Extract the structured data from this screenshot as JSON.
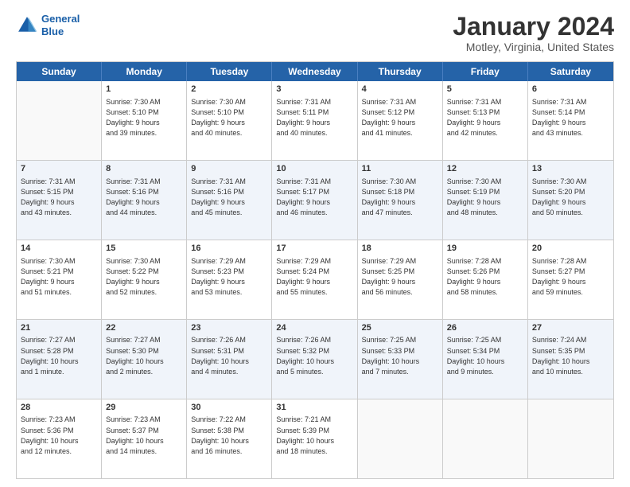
{
  "logo": {
    "line1": "General",
    "line2": "Blue"
  },
  "title": "January 2024",
  "subtitle": "Motley, Virginia, United States",
  "days": [
    "Sunday",
    "Monday",
    "Tuesday",
    "Wednesday",
    "Thursday",
    "Friday",
    "Saturday"
  ],
  "rows": [
    [
      {
        "day": "",
        "text": ""
      },
      {
        "day": "1",
        "text": "Sunrise: 7:30 AM\nSunset: 5:10 PM\nDaylight: 9 hours\nand 39 minutes."
      },
      {
        "day": "2",
        "text": "Sunrise: 7:30 AM\nSunset: 5:10 PM\nDaylight: 9 hours\nand 40 minutes."
      },
      {
        "day": "3",
        "text": "Sunrise: 7:31 AM\nSunset: 5:11 PM\nDaylight: 9 hours\nand 40 minutes."
      },
      {
        "day": "4",
        "text": "Sunrise: 7:31 AM\nSunset: 5:12 PM\nDaylight: 9 hours\nand 41 minutes."
      },
      {
        "day": "5",
        "text": "Sunrise: 7:31 AM\nSunset: 5:13 PM\nDaylight: 9 hours\nand 42 minutes."
      },
      {
        "day": "6",
        "text": "Sunrise: 7:31 AM\nSunset: 5:14 PM\nDaylight: 9 hours\nand 43 minutes."
      }
    ],
    [
      {
        "day": "7",
        "text": "Sunrise: 7:31 AM\nSunset: 5:15 PM\nDaylight: 9 hours\nand 43 minutes."
      },
      {
        "day": "8",
        "text": "Sunrise: 7:31 AM\nSunset: 5:16 PM\nDaylight: 9 hours\nand 44 minutes."
      },
      {
        "day": "9",
        "text": "Sunrise: 7:31 AM\nSunset: 5:16 PM\nDaylight: 9 hours\nand 45 minutes."
      },
      {
        "day": "10",
        "text": "Sunrise: 7:31 AM\nSunset: 5:17 PM\nDaylight: 9 hours\nand 46 minutes."
      },
      {
        "day": "11",
        "text": "Sunrise: 7:30 AM\nSunset: 5:18 PM\nDaylight: 9 hours\nand 47 minutes."
      },
      {
        "day": "12",
        "text": "Sunrise: 7:30 AM\nSunset: 5:19 PM\nDaylight: 9 hours\nand 48 minutes."
      },
      {
        "day": "13",
        "text": "Sunrise: 7:30 AM\nSunset: 5:20 PM\nDaylight: 9 hours\nand 50 minutes."
      }
    ],
    [
      {
        "day": "14",
        "text": "Sunrise: 7:30 AM\nSunset: 5:21 PM\nDaylight: 9 hours\nand 51 minutes."
      },
      {
        "day": "15",
        "text": "Sunrise: 7:30 AM\nSunset: 5:22 PM\nDaylight: 9 hours\nand 52 minutes."
      },
      {
        "day": "16",
        "text": "Sunrise: 7:29 AM\nSunset: 5:23 PM\nDaylight: 9 hours\nand 53 minutes."
      },
      {
        "day": "17",
        "text": "Sunrise: 7:29 AM\nSunset: 5:24 PM\nDaylight: 9 hours\nand 55 minutes."
      },
      {
        "day": "18",
        "text": "Sunrise: 7:29 AM\nSunset: 5:25 PM\nDaylight: 9 hours\nand 56 minutes."
      },
      {
        "day": "19",
        "text": "Sunrise: 7:28 AM\nSunset: 5:26 PM\nDaylight: 9 hours\nand 58 minutes."
      },
      {
        "day": "20",
        "text": "Sunrise: 7:28 AM\nSunset: 5:27 PM\nDaylight: 9 hours\nand 59 minutes."
      }
    ],
    [
      {
        "day": "21",
        "text": "Sunrise: 7:27 AM\nSunset: 5:28 PM\nDaylight: 10 hours\nand 1 minute."
      },
      {
        "day": "22",
        "text": "Sunrise: 7:27 AM\nSunset: 5:30 PM\nDaylight: 10 hours\nand 2 minutes."
      },
      {
        "day": "23",
        "text": "Sunrise: 7:26 AM\nSunset: 5:31 PM\nDaylight: 10 hours\nand 4 minutes."
      },
      {
        "day": "24",
        "text": "Sunrise: 7:26 AM\nSunset: 5:32 PM\nDaylight: 10 hours\nand 5 minutes."
      },
      {
        "day": "25",
        "text": "Sunrise: 7:25 AM\nSunset: 5:33 PM\nDaylight: 10 hours\nand 7 minutes."
      },
      {
        "day": "26",
        "text": "Sunrise: 7:25 AM\nSunset: 5:34 PM\nDaylight: 10 hours\nand 9 minutes."
      },
      {
        "day": "27",
        "text": "Sunrise: 7:24 AM\nSunset: 5:35 PM\nDaylight: 10 hours\nand 10 minutes."
      }
    ],
    [
      {
        "day": "28",
        "text": "Sunrise: 7:23 AM\nSunset: 5:36 PM\nDaylight: 10 hours\nand 12 minutes."
      },
      {
        "day": "29",
        "text": "Sunrise: 7:23 AM\nSunset: 5:37 PM\nDaylight: 10 hours\nand 14 minutes."
      },
      {
        "day": "30",
        "text": "Sunrise: 7:22 AM\nSunset: 5:38 PM\nDaylight: 10 hours\nand 16 minutes."
      },
      {
        "day": "31",
        "text": "Sunrise: 7:21 AM\nSunset: 5:39 PM\nDaylight: 10 hours\nand 18 minutes."
      },
      {
        "day": "",
        "text": ""
      },
      {
        "day": "",
        "text": ""
      },
      {
        "day": "",
        "text": ""
      }
    ]
  ]
}
